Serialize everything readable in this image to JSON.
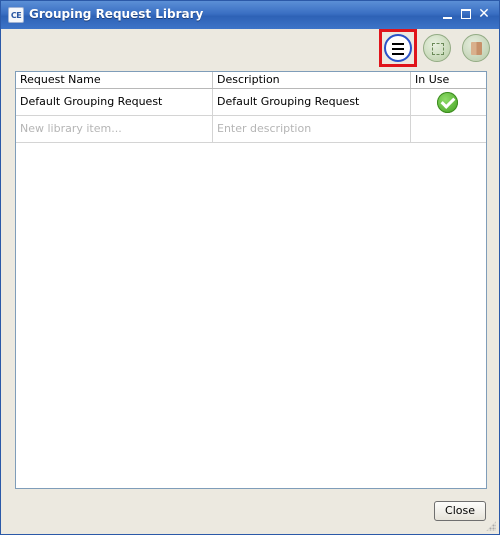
{
  "window": {
    "title": "Grouping Request Library",
    "app_icon_text": "CE",
    "controls": {
      "minimize": "minimize",
      "maximize": "maximize",
      "close": "✕"
    }
  },
  "toolbar": {
    "buttons": [
      {
        "name": "menu",
        "icon": "hamburger-menu-icon",
        "highlighted": true
      },
      {
        "name": "select",
        "icon": "select-region-icon"
      },
      {
        "name": "package",
        "icon": "package-icon"
      }
    ],
    "highlight_color": "#e0141b"
  },
  "table": {
    "columns": [
      "Request Name",
      "Description",
      "In Use"
    ],
    "rows": [
      {
        "name": "Default Grouping Request",
        "description": "Default Grouping Request",
        "in_use": true
      }
    ],
    "new_row": {
      "name_placeholder": "New library item...",
      "description_placeholder": "Enter description"
    }
  },
  "footer": {
    "close_label": "Close"
  },
  "colors": {
    "title_bar": "#3a6fc3",
    "check": "#4caf2a",
    "window_bg": "#ece9e0"
  }
}
